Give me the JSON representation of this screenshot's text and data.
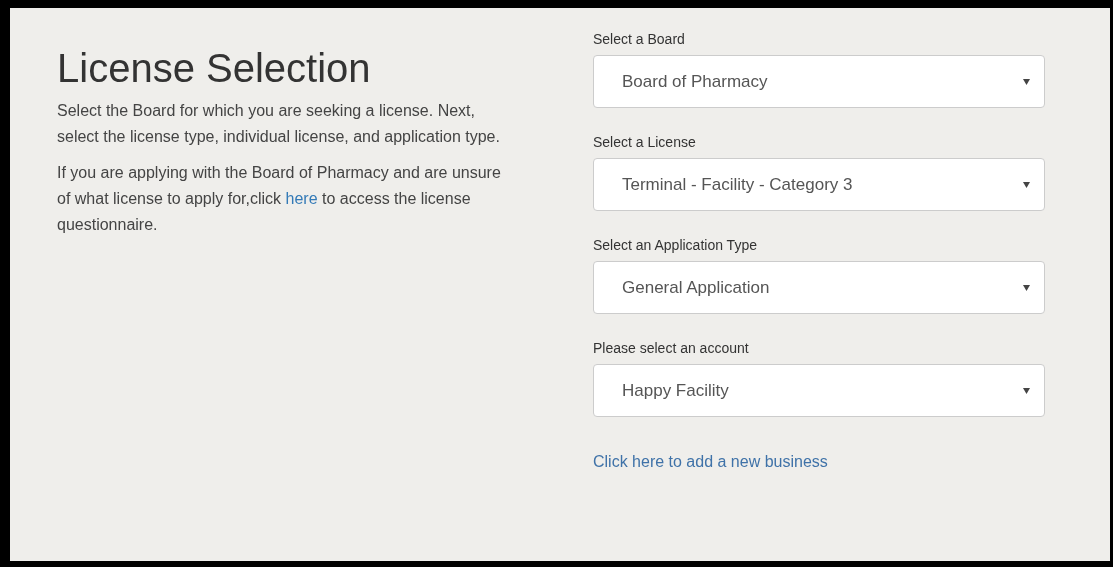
{
  "heading": "License Selection",
  "paragraphs": [
    {
      "text": "Select the Board for which you are seeking a license. Next, select the license type, individual license, and application type."
    },
    {
      "text": "If you are applying with the Board of Pharmacy and are unsure of what license to apply for,click ",
      "link": "here",
      "text_after": " to access the license questionnaire."
    }
  ],
  "fields": [
    {
      "label": "Select a Board",
      "value": "Board of Pharmacy"
    },
    {
      "label": "Select a License",
      "value": "Terminal - Facility - Category 3"
    },
    {
      "label": "Select an Application Type",
      "value": "General Application"
    },
    {
      "label": "Please select an account",
      "value": "Happy Facility"
    }
  ],
  "add_link": "Click here to add a new business"
}
